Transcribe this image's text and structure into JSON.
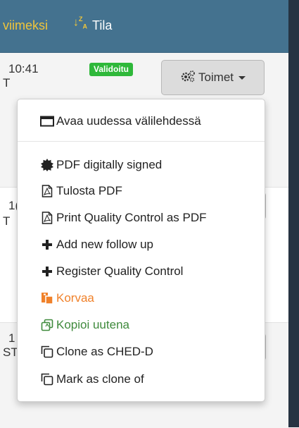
{
  "header": {
    "sort_label": "viimeksi",
    "sort_icon": "↓ᶻₐ",
    "status_label": "Tila"
  },
  "row1": {
    "time": "10:41",
    "sub": "T",
    "badge": "Validoitu"
  },
  "row2": {
    "time": "1(",
    "sub": "T"
  },
  "row3": {
    "time": "1",
    "sub": "ST"
  },
  "toimet": {
    "label": "Toimet"
  },
  "menu": {
    "items": [
      {
        "label": "Avaa uudessa välilehdessä",
        "icon": "window-icon",
        "color": "#222222"
      },
      {
        "label": "PDF digitally signed",
        "icon": "seal-icon",
        "color": "#222222"
      },
      {
        "label": "Tulosta PDF",
        "icon": "pdf-icon",
        "color": "#222222"
      },
      {
        "label": "Print Quality Control as PDF",
        "icon": "pdf-icon",
        "color": "#222222"
      },
      {
        "label": "Add new follow up",
        "icon": "plus-icon",
        "color": "#222222"
      },
      {
        "label": "Register Quality Control",
        "icon": "plus-icon",
        "color": "#222222"
      },
      {
        "label": "Korvaa",
        "icon": "replace-icon",
        "color": "#f0812a"
      },
      {
        "label": "Kopioi uutena",
        "icon": "copy-icon",
        "color": "#3f8a3c"
      },
      {
        "label": "Clone as CHED-D",
        "icon": "clone-icon",
        "color": "#222222"
      },
      {
        "label": "Mark as clone of",
        "icon": "clone-icon",
        "color": "#222222"
      }
    ]
  },
  "colors": {
    "header_bg": "#44728f",
    "sort_accent": "#f0c53a",
    "badge_green": "#2fb83a",
    "dark_bar": "#263342"
  }
}
